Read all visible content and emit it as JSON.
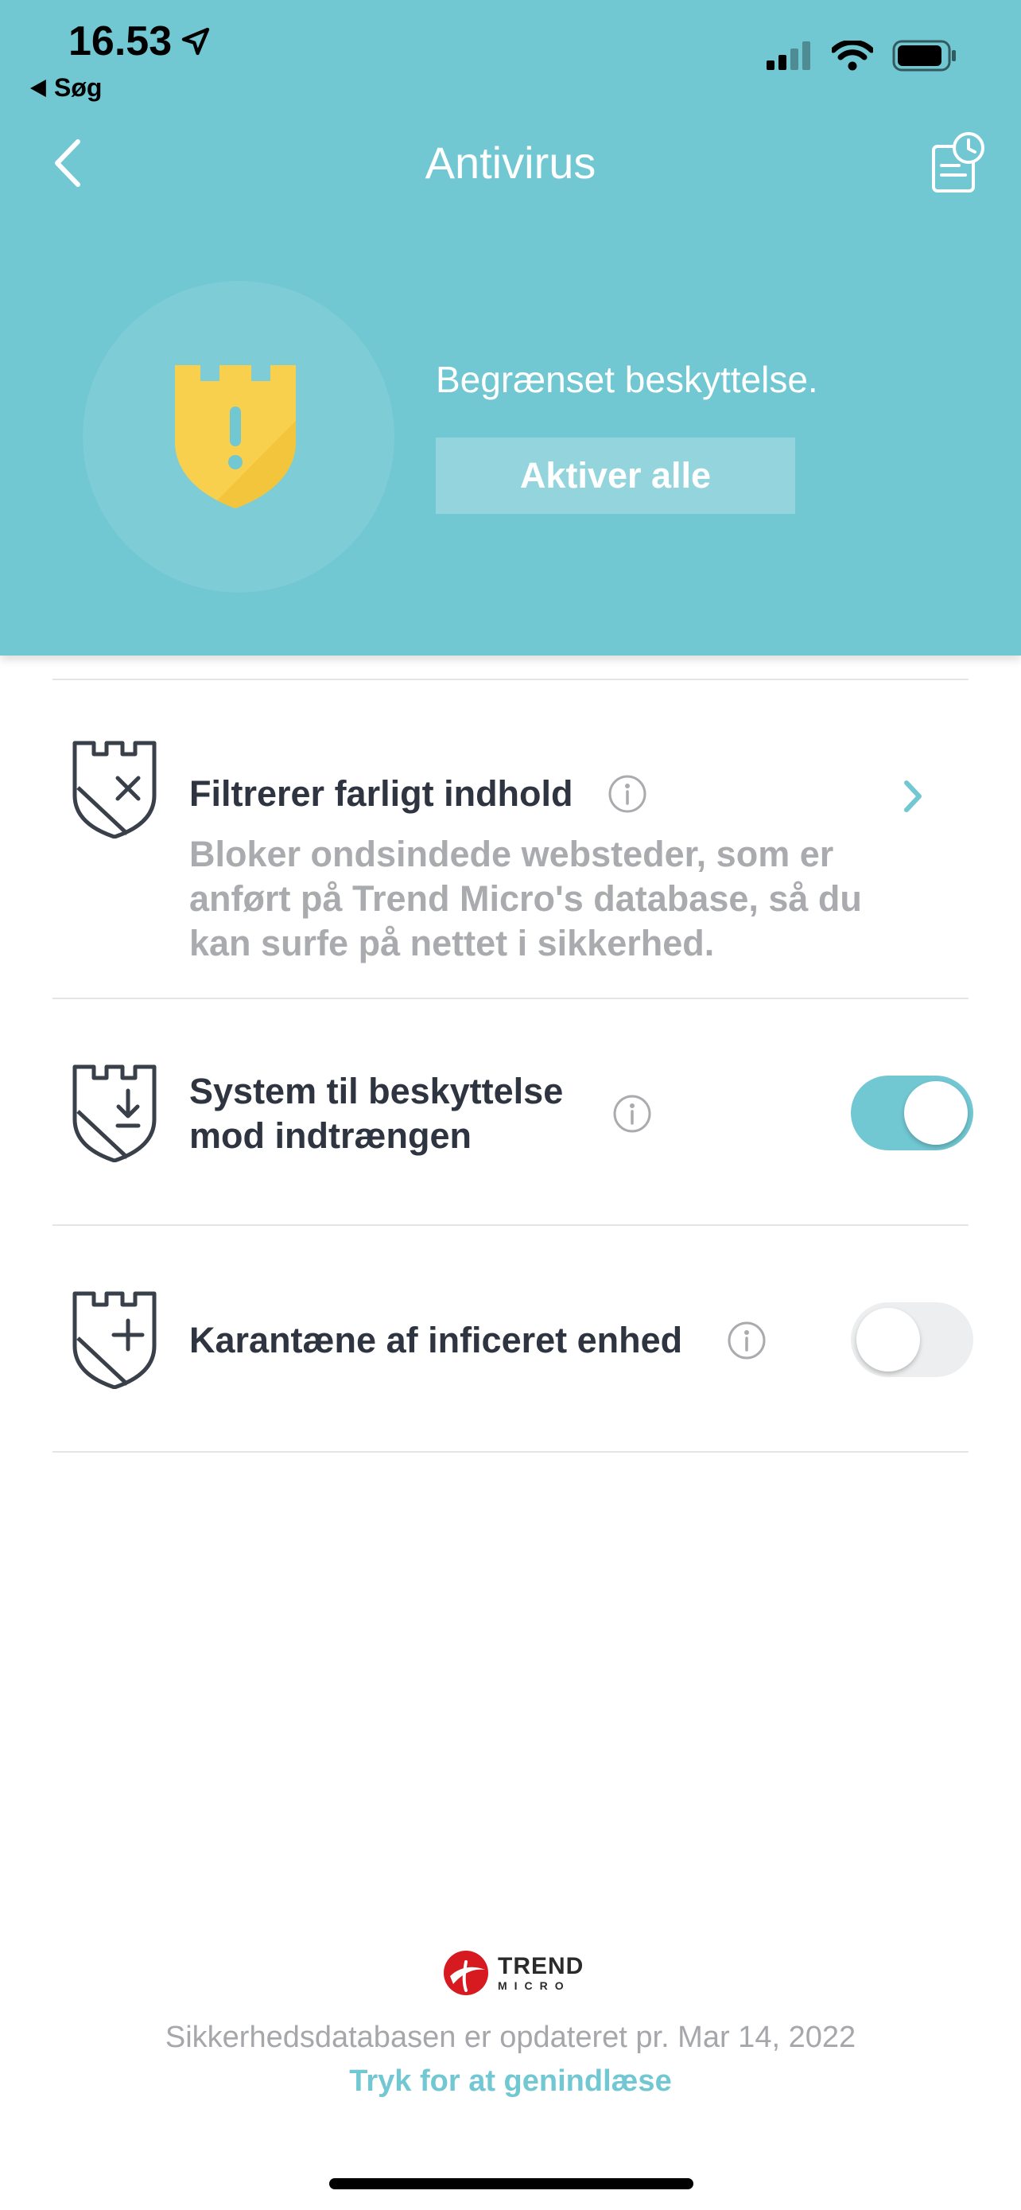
{
  "status_bar": {
    "time": "16.53",
    "back_label": "Søg"
  },
  "header": {
    "title": "Antivirus",
    "status_text": "Begrænset beskyttelse.",
    "activate_label": "Aktiver alle",
    "accent_color": "#71c7d2",
    "shield_color": "#f8d04d"
  },
  "items": [
    {
      "title": "Filtrerer farligt indhold",
      "description": "Bloker ondsindede websteder, som er anført på Trend Micro's database, så du kan surfe på nettet i sikkerhed.",
      "icon": "shield-x-icon"
    },
    {
      "title_line1": "System til beskyttelse",
      "title_line2": "mod indtrængen",
      "enabled": true,
      "icon": "shield-download-icon"
    },
    {
      "title": "Karantæne af inficeret enhed",
      "enabled": false,
      "icon": "shield-plus-icon"
    }
  ],
  "footer": {
    "logo_line1": "TREND",
    "logo_line2": "MICRO",
    "database_text": "Sikkerhedsdatabasen er opdateret pr. Mar 14, 2022",
    "reload_label": "Tryk for at genindlæse"
  }
}
